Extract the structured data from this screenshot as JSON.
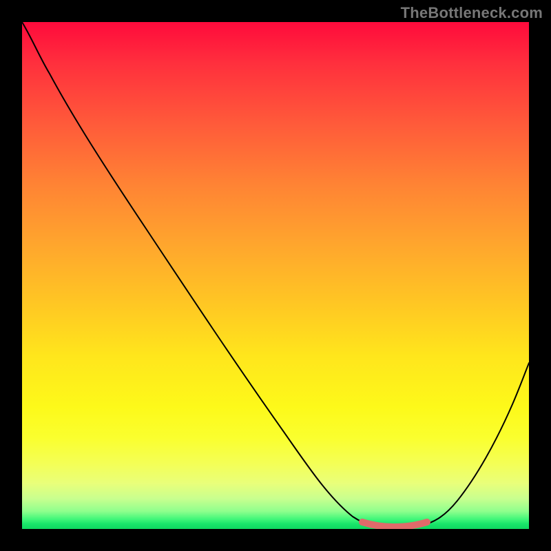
{
  "watermark": "TheBottleneck.com",
  "colors": {
    "background": "#000000",
    "gradient_top": "#ff0a3c",
    "gradient_mid": "#ffe61c",
    "gradient_bottom": "#0fd860",
    "curve_stroke": "#000000",
    "highlight_stroke": "#e06a6a"
  },
  "chart_data": {
    "type": "line",
    "title": "",
    "xlabel": "",
    "ylabel": "",
    "xlim": [
      0,
      100
    ],
    "ylim": [
      0,
      100
    ],
    "series": [
      {
        "name": "bottleneck-curve",
        "x": [
          0,
          4,
          8,
          12,
          16,
          24,
          32,
          40,
          48,
          56,
          62,
          66,
          69,
          72,
          76,
          80,
          84,
          88,
          92,
          96,
          100
        ],
        "values": [
          100,
          96,
          91,
          85,
          79,
          67,
          55,
          43,
          31,
          19,
          10,
          4,
          1,
          0,
          0,
          2,
          8,
          16,
          25,
          34,
          43
        ]
      }
    ],
    "highlight_range_x": [
      67,
      80
    ],
    "annotations": []
  }
}
